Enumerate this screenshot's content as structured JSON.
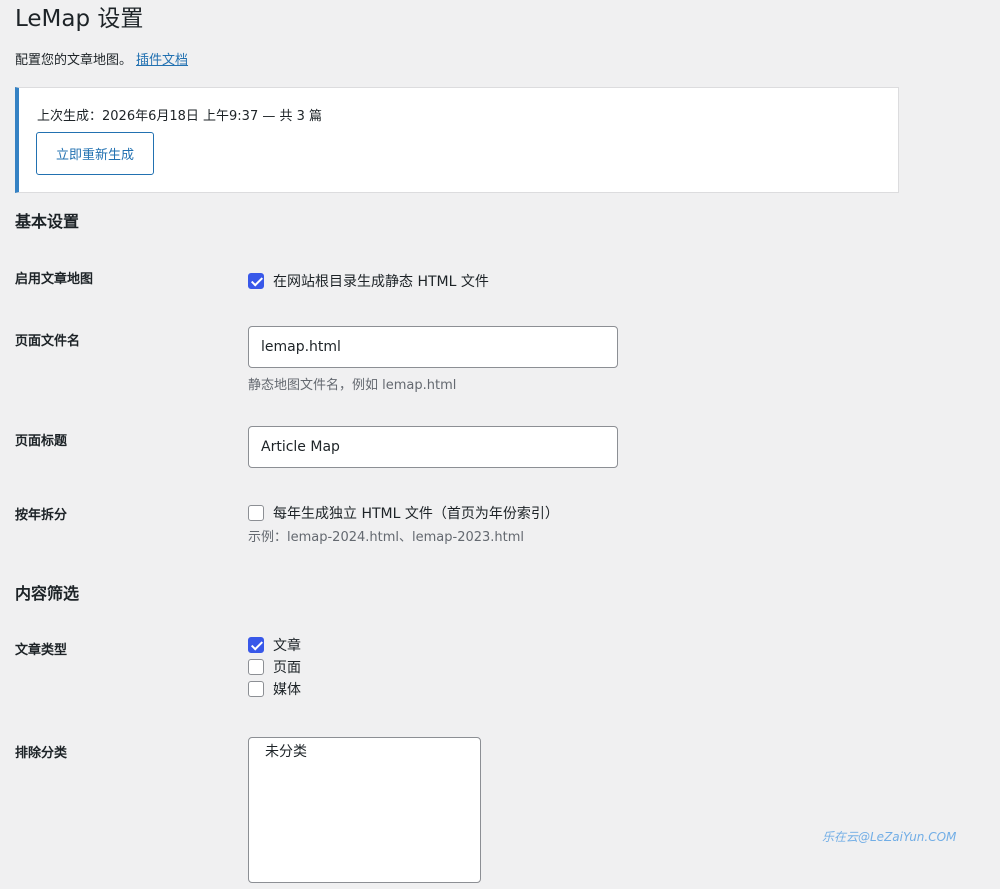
{
  "page": {
    "title": "LeMap 设置",
    "description": "配置您的文章地图。",
    "docs_link": "插件文档"
  },
  "notice": {
    "status": "上次生成：2026年6月18日 上午9:37 — 共 3 篇",
    "regenerate_button": "立即重新生成"
  },
  "sections": {
    "basic": "基本设置",
    "content": "内容筛选"
  },
  "enable": {
    "label": "启用文章地图",
    "checkbox_label": "在网站根目录生成静态 HTML 文件",
    "checked": true
  },
  "filename": {
    "label": "页面文件名",
    "value": "lemap.html",
    "help": "静态地图文件名，例如 lemap.html"
  },
  "page_title_field": {
    "label": "页面标题",
    "value": "Article Map"
  },
  "split_by_year": {
    "label": "按年拆分",
    "checkbox_label": "每年生成独立 HTML 文件（首页为年份索引）",
    "checked": false,
    "help": "示例：lemap-2024.html、lemap-2023.html"
  },
  "post_types": {
    "label": "文章类型",
    "options": [
      {
        "label": "文章",
        "checked": true
      },
      {
        "label": "页面",
        "checked": false
      },
      {
        "label": "媒体",
        "checked": false
      }
    ]
  },
  "exclude_categories": {
    "label": "排除分类",
    "options": [
      "未分类"
    ]
  },
  "watermark": "乐在云@LeZaiYun.COM"
}
